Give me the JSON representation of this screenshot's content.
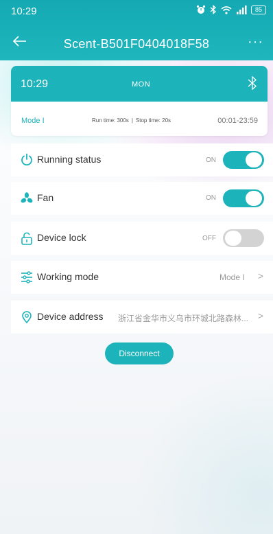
{
  "status_bar": {
    "time": "10:29",
    "battery": "85"
  },
  "nav": {
    "back_icon": "arrow-left-icon",
    "title": "Scent-B501F0404018F58",
    "more": "···"
  },
  "schedule_card": {
    "time": "10:29",
    "day": "MON",
    "mode": "Mode I",
    "run_time": "Run time:  300s",
    "separator": "|",
    "stop_time": "Stop time:  20s",
    "time_range": "00:01-23:59"
  },
  "settings": {
    "running_status": {
      "label": "Running status",
      "state": "ON",
      "enabled": true
    },
    "fan": {
      "label": "Fan",
      "state": "ON",
      "enabled": true
    },
    "device_lock": {
      "label": "Device lock",
      "state": "OFF",
      "enabled": false
    },
    "working_mode": {
      "label": "Working mode",
      "value": "Mode I",
      "chevron": ">"
    },
    "device_address": {
      "label": "Device address",
      "value": "浙江省金华市义乌市环城北路森林...",
      "chevron": ">"
    }
  },
  "actions": {
    "disconnect_label": "Disconnect"
  },
  "colors": {
    "accent": "#1db3bb",
    "toggle_off": "#d3d3d3"
  }
}
